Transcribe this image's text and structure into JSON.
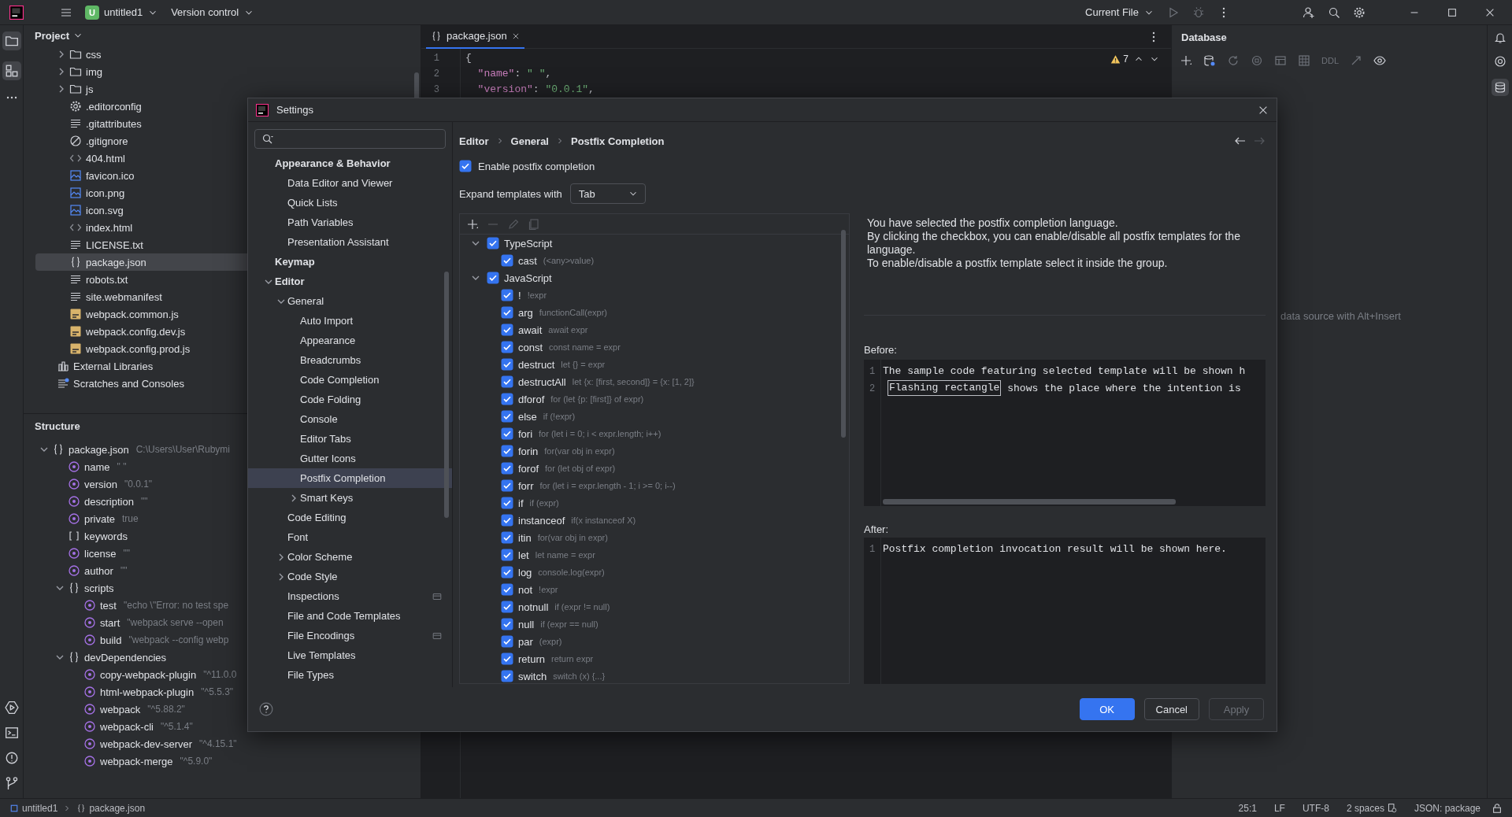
{
  "topbar": {
    "project_badge": "U",
    "project": "untitled1",
    "vcs": "Version control",
    "run_config": "Current File"
  },
  "project_panel": {
    "title": "Project",
    "tree": [
      {
        "children": [
          {
            "label": "css",
            "kind": "folder",
            "expanded": false,
            "selected": false
          },
          {
            "label": "img",
            "kind": "folder",
            "expanded": false,
            "selected": false
          },
          {
            "label": "js",
            "kind": "folder",
            "expanded": false,
            "selected": false
          },
          {
            "label": ".editorconfig",
            "kind": "config",
            "selected": false
          },
          {
            "label": ".gitattributes",
            "kind": "text",
            "selected": false
          },
          {
            "label": ".gitignore",
            "kind": "ignore",
            "selected": false
          },
          {
            "label": "404.html",
            "kind": "html",
            "selected": false
          },
          {
            "label": "favicon.ico",
            "kind": "image",
            "selected": false
          },
          {
            "label": "icon.png",
            "kind": "image",
            "selected": false
          },
          {
            "label": "icon.svg",
            "kind": "image",
            "selected": false
          },
          {
            "label": "index.html",
            "kind": "html",
            "selected": false
          },
          {
            "label": "LICENSE.txt",
            "kind": "text",
            "selected": false
          },
          {
            "label": "package.json",
            "kind": "json",
            "selected": true
          },
          {
            "label": "robots.txt",
            "kind": "text",
            "selected": false
          },
          {
            "label": "site.webmanifest",
            "kind": "text",
            "selected": false
          },
          {
            "label": "webpack.common.js",
            "kind": "script",
            "selected": false
          },
          {
            "label": "webpack.config.dev.js",
            "kind": "script",
            "selected": false
          },
          {
            "label": "webpack.config.prod.js",
            "kind": "script",
            "selected": false
          }
        ]
      },
      {
        "label": "External Libraries",
        "kind": "library",
        "selected": false
      },
      {
        "label": "Scratches and Consoles",
        "kind": "scratch",
        "selected": false
      }
    ]
  },
  "structure_panel": {
    "title": "Structure",
    "tree": [
      {
        "label": "package.json",
        "value": "C:\\Users\\User\\Rubymi",
        "kind": "object",
        "expanded": true,
        "children": [
          {
            "label": "name",
            "value": "\" \"",
            "kind": "property"
          },
          {
            "label": "version",
            "value": "\"0.0.1\"",
            "kind": "property"
          },
          {
            "label": "description",
            "value": "\"\"",
            "kind": "property"
          },
          {
            "label": "private",
            "value": "true",
            "kind": "property"
          },
          {
            "label": "keywords",
            "kind": "array"
          },
          {
            "label": "license",
            "value": "\"\"",
            "kind": "property"
          },
          {
            "label": "author",
            "value": "\"\"",
            "kind": "property"
          },
          {
            "label": "scripts",
            "kind": "object",
            "expanded": true,
            "children": [
              {
                "label": "test",
                "value": "\"echo \\\"Error: no test spe",
                "kind": "property"
              },
              {
                "label": "start",
                "value": "\"webpack serve --open",
                "kind": "property"
              },
              {
                "label": "build",
                "value": "\"webpack --config webp",
                "kind": "property"
              }
            ]
          },
          {
            "label": "devDependencies",
            "kind": "object",
            "expanded": true,
            "children": [
              {
                "label": "copy-webpack-plugin",
                "value": "\"^11.0.0",
                "kind": "property"
              },
              {
                "label": "html-webpack-plugin",
                "value": "\"^5.5.3\"",
                "kind": "property"
              },
              {
                "label": "webpack",
                "value": "\"^5.88.2\"",
                "kind": "property"
              },
              {
                "label": "webpack-cli",
                "value": "\"^5.1.4\"",
                "kind": "property"
              },
              {
                "label": "webpack-dev-server",
                "value": "\"^4.15.1\"",
                "kind": "property"
              },
              {
                "label": "webpack-merge",
                "value": "\"^5.9.0\"",
                "kind": "property"
              }
            ]
          }
        ]
      }
    ]
  },
  "editor": {
    "tab": "package.json",
    "warnings": "7",
    "lines": [
      {
        "number": "1",
        "tokens": [
          {
            "text": "{",
            "kind": "punct"
          }
        ]
      },
      {
        "number": "2",
        "tokens": [
          {
            "text": "  \"name\"",
            "kind": "key"
          },
          {
            "text": ": ",
            "kind": "punct"
          },
          {
            "text": "\" \"",
            "kind": "string"
          },
          {
            "text": ",",
            "kind": "punct"
          }
        ]
      },
      {
        "number": "3",
        "tokens": [
          {
            "text": "  \"version\"",
            "kind": "key"
          },
          {
            "text": ": ",
            "kind": "punct"
          },
          {
            "text": "\"0.0.1\"",
            "kind": "string"
          },
          {
            "text": ",",
            "kind": "punct"
          }
        ]
      }
    ]
  },
  "database": {
    "title": "Database",
    "toolbar_label": "DDL",
    "hint": "data source with Alt+Insert"
  },
  "settings": {
    "title": "Settings",
    "nav": [
      {
        "label": "Appearance & Behavior",
        "selected": false,
        "children": [
          {
            "label": "Data Editor and Viewer",
            "selected": false
          },
          {
            "label": "Quick Lists",
            "selected": false
          },
          {
            "label": "Path Variables",
            "selected": false
          },
          {
            "label": "Presentation Assistant",
            "selected": false
          }
        ]
      },
      {
        "label": "Keymap",
        "selected": false
      },
      {
        "label": "Editor",
        "selected": false,
        "expanded": true,
        "children": [
          {
            "label": "General",
            "selected": false,
            "expanded": true,
            "children": [
              {
                "label": "Auto Import",
                "selected": false
              },
              {
                "label": "Appearance",
                "selected": false
              },
              {
                "label": "Breadcrumbs",
                "selected": false
              },
              {
                "label": "Code Completion",
                "selected": false
              },
              {
                "label": "Code Folding",
                "selected": false
              },
              {
                "label": "Console",
                "selected": false
              },
              {
                "label": "Editor Tabs",
                "selected": false
              },
              {
                "label": "Gutter Icons",
                "selected": false
              },
              {
                "label": "Postfix Completion",
                "selected": true
              },
              {
                "label": "Smart Keys",
                "selected": false,
                "expanded": false
              }
            ]
          },
          {
            "label": "Code Editing",
            "selected": false
          },
          {
            "label": "Font",
            "selected": false
          },
          {
            "label": "Color Scheme",
            "selected": false,
            "expanded": false
          },
          {
            "label": "Code Style",
            "selected": false,
            "expanded": false
          },
          {
            "label": "Inspections",
            "selected": false,
            "project_level": true
          },
          {
            "label": "File and Code Templates",
            "selected": false
          },
          {
            "label": "File Encodings",
            "selected": false,
            "project_level": true
          },
          {
            "label": "Live Templates",
            "selected": false
          },
          {
            "label": "File Types",
            "selected": false
          }
        ]
      }
    ],
    "breadcrumb": [
      "Editor",
      "General",
      "Postfix Completion"
    ],
    "enable": {
      "label": "Enable postfix completion",
      "checked": true
    },
    "expand": {
      "label": "Expand templates with",
      "value": "Tab"
    },
    "templates": [
      {
        "label": "TypeScript",
        "checked": true,
        "expanded": true,
        "children": [
          {
            "label": "cast",
            "hint": "(<any>value)",
            "checked": true
          }
        ]
      },
      {
        "label": "JavaScript",
        "checked": true,
        "expanded": true,
        "children": [
          {
            "label": "!",
            "hint": "!expr",
            "checked": true
          },
          {
            "label": "arg",
            "hint": "functionCall(expr)",
            "checked": true
          },
          {
            "label": "await",
            "hint": "await expr",
            "checked": true
          },
          {
            "label": "const",
            "hint": "const name = expr",
            "checked": true
          },
          {
            "label": "destruct",
            "hint": "let {} = expr",
            "checked": true
          },
          {
            "label": "destructAll",
            "hint": "let {x: [first, second]} = {x: [1, 2]}",
            "checked": true
          },
          {
            "label": "dforof",
            "hint": "for (let {p: [first]} of expr)",
            "checked": true
          },
          {
            "label": "else",
            "hint": "if (!expr)",
            "checked": true
          },
          {
            "label": "fori",
            "hint": "for (let i = 0; i < expr.length; i++)",
            "checked": true
          },
          {
            "label": "forin",
            "hint": "for(var obj in expr)",
            "checked": true
          },
          {
            "label": "forof",
            "hint": "for (let obj of expr)",
            "checked": true
          },
          {
            "label": "forr",
            "hint": "for (let i = expr.length - 1; i >= 0; i--)",
            "checked": true
          },
          {
            "label": "if",
            "hint": "if (expr)",
            "checked": true
          },
          {
            "label": "instanceof",
            "hint": "if(x instanceof X)",
            "checked": true
          },
          {
            "label": "itin",
            "hint": "for(var obj in expr)",
            "checked": true
          },
          {
            "label": "let",
            "hint": "let name = expr",
            "checked": true
          },
          {
            "label": "log",
            "hint": "console.log(expr)",
            "checked": true
          },
          {
            "label": "not",
            "hint": "!expr",
            "checked": true
          },
          {
            "label": "notnull",
            "hint": "if (expr != null)",
            "checked": true
          },
          {
            "label": "null",
            "hint": "if (expr == null)",
            "checked": true
          },
          {
            "label": "par",
            "hint": "(expr)",
            "checked": true
          },
          {
            "label": "return",
            "hint": "return expr",
            "checked": true
          },
          {
            "label": "switch",
            "hint": "switch (x) {...}",
            "checked": true
          }
        ]
      }
    ],
    "description": "You have selected the postfix completion language.\nBy clicking the checkbox, you can enable/disable all postfix templates for the language.\nTo enable/disable a postfix template select it inside the group.",
    "before": {
      "label": "Before:",
      "lines": [
        {
          "number": "1",
          "text": "The sample code featuring selected template will be shown h"
        },
        {
          "number": "2",
          "highlight": "Flashing rectangle",
          "text": " shows the place where the intention is"
        }
      ]
    },
    "after": {
      "label": "After:",
      "lines": [
        {
          "number": "1",
          "text": "Postfix completion invocation result will be shown here."
        }
      ]
    },
    "buttons": [
      {
        "label": "OK",
        "kind": "primary"
      },
      {
        "label": "Cancel",
        "kind": "normal"
      },
      {
        "label": "Apply",
        "kind": "disabled"
      }
    ]
  },
  "status_bar": {
    "path": [
      "untitled1",
      "package.json"
    ],
    "items": [
      "25:1",
      "LF",
      "UTF-8",
      "2 spaces",
      "JSON: package"
    ]
  }
}
